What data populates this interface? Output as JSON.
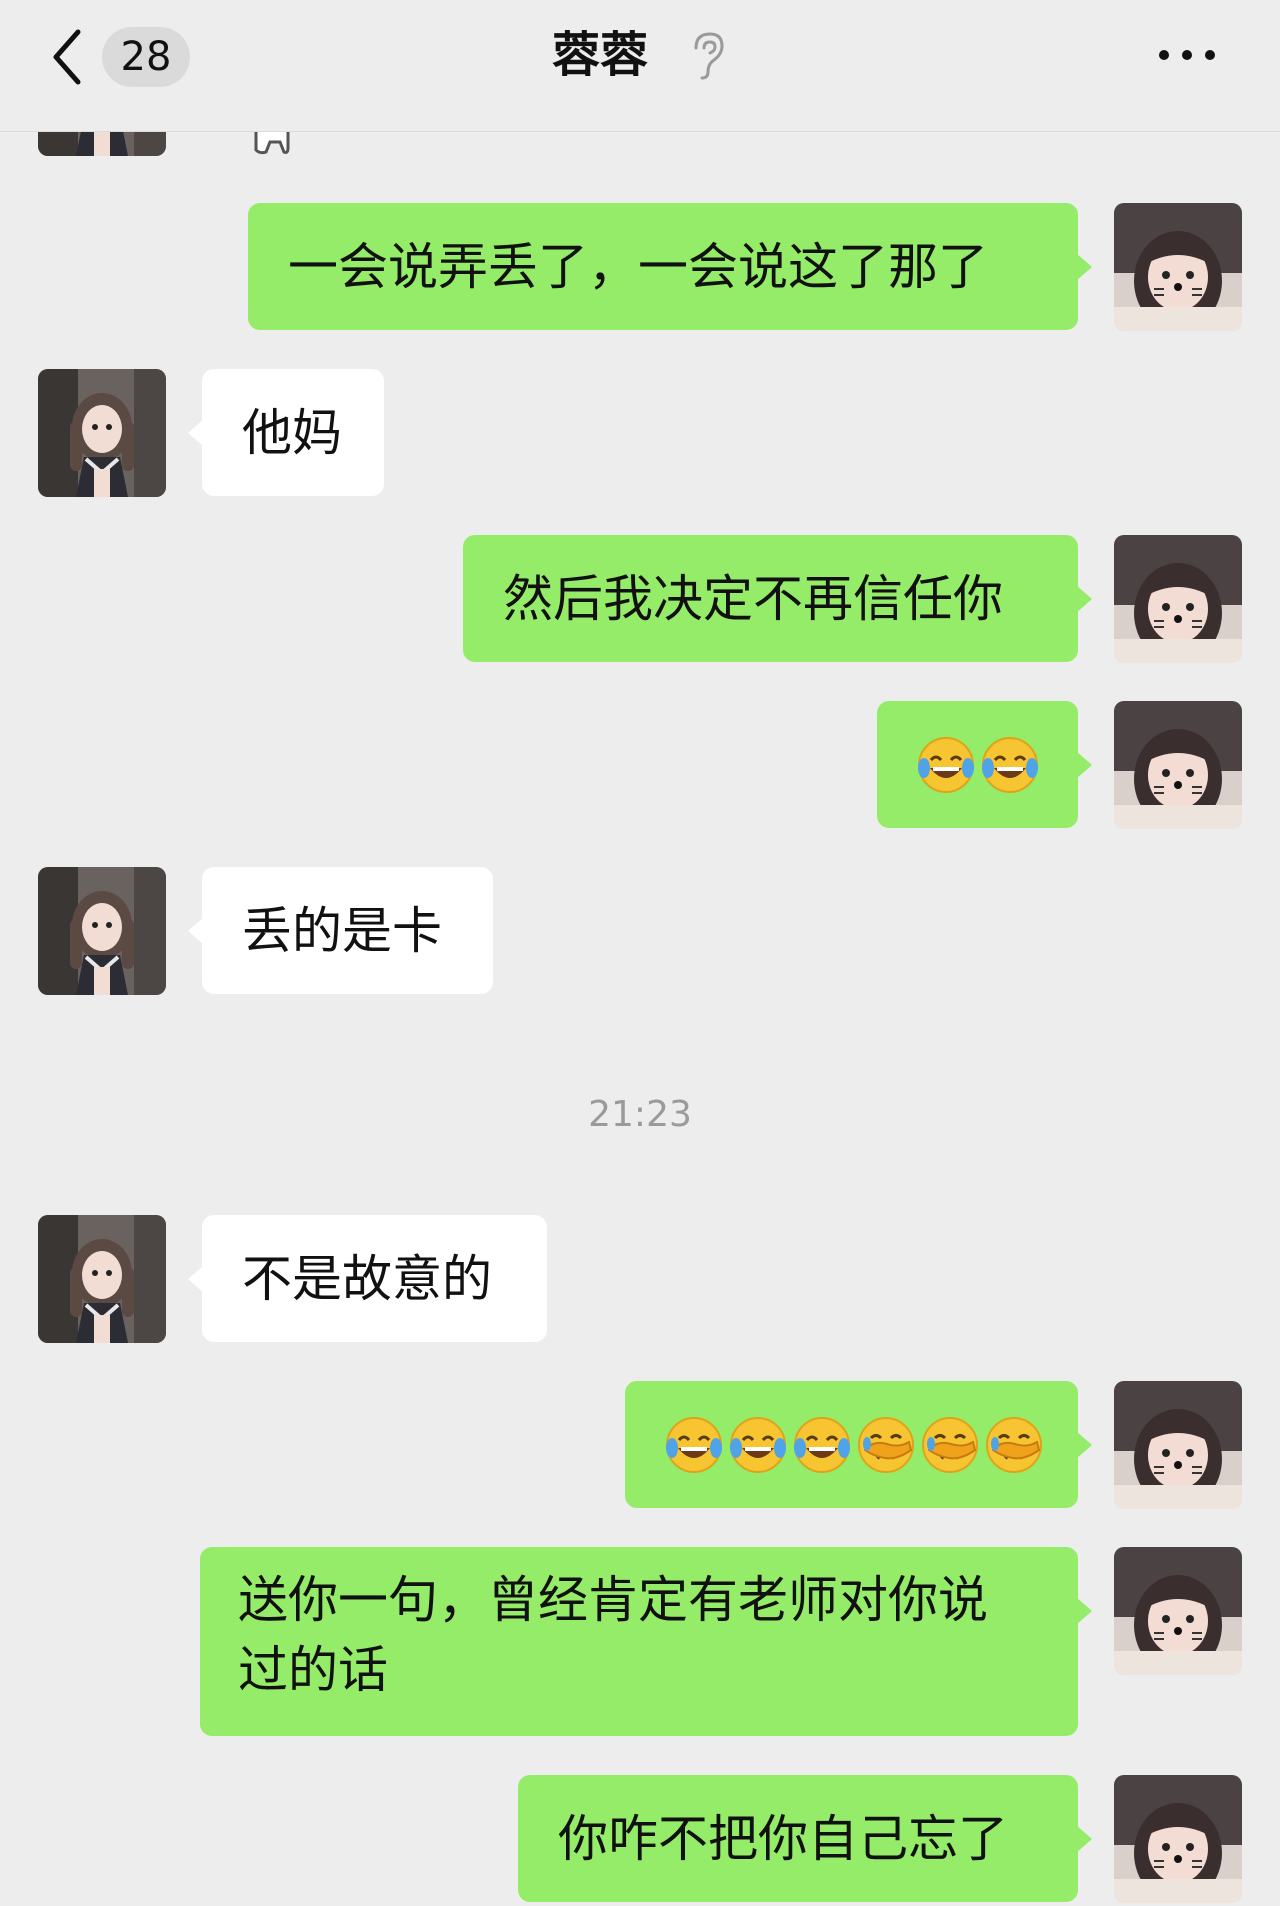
{
  "header": {
    "unread_count": "28",
    "title": "蓉蓉"
  },
  "timestamp": "21:23",
  "messages": [
    {
      "side": "sent",
      "text": "一会说弄丢了，一会说这了那了"
    },
    {
      "side": "recv",
      "text": "他妈"
    },
    {
      "side": "sent",
      "text": "然后我决定不再信任你"
    },
    {
      "side": "sent",
      "emojis": [
        "tears-of-joy-emoji",
        "tears-of-joy-emoji"
      ]
    },
    {
      "side": "recv",
      "text": "丢的是卡"
    },
    {
      "side": "recv",
      "text": "不是故意的"
    },
    {
      "side": "sent",
      "emojis": [
        "tears-of-joy-emoji",
        "tears-of-joy-emoji",
        "tears-of-joy-emoji",
        "facepalm-emoji",
        "facepalm-emoji",
        "facepalm-emoji"
      ]
    },
    {
      "side": "sent",
      "text_lines": [
        "送你一句，曾经肯定有老师对你说",
        "过的话"
      ]
    },
    {
      "side": "sent",
      "text": "你咋不把你自己忘了"
    }
  ],
  "colors": {
    "background": "#ededed",
    "sent_bubble": "#95ec69",
    "received_bubble": "#ffffff"
  }
}
